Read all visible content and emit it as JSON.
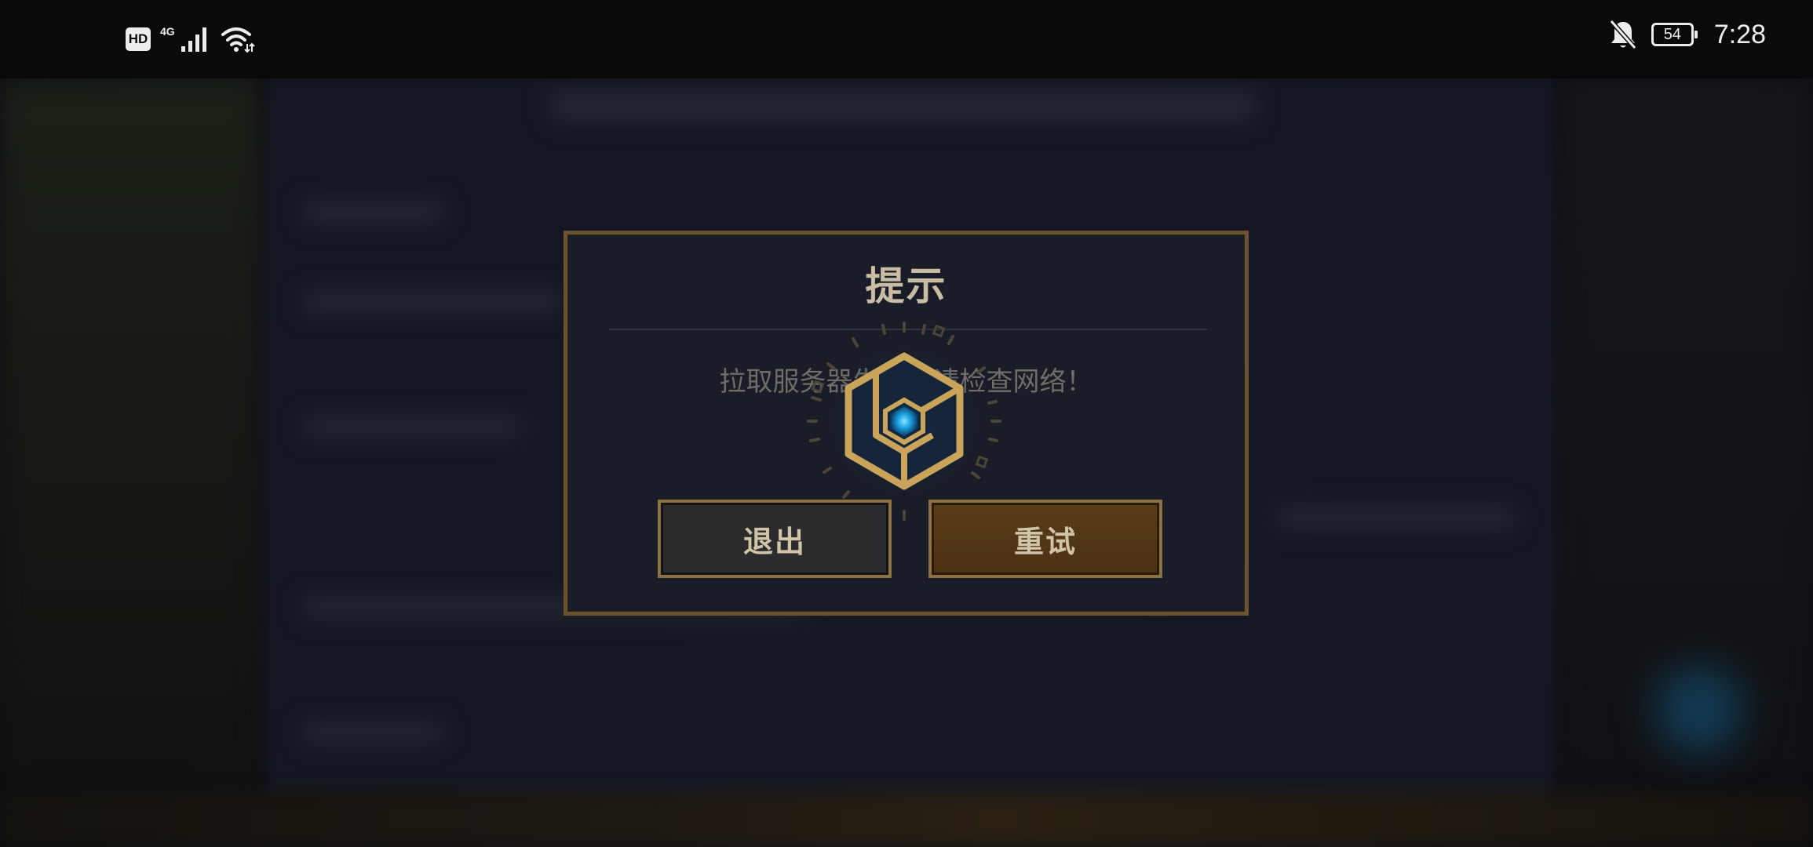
{
  "status_bar": {
    "hd_label": "HD",
    "network_type": "4G",
    "battery_level": "54",
    "time": "7:28",
    "icons": [
      "hd-icon",
      "cellular-signal-icon",
      "wifi-icon",
      "bell-muted-icon",
      "battery-icon"
    ]
  },
  "dialog": {
    "title": "提示",
    "message": "拉取服务器失败，请检查网络！",
    "buttons": {
      "exit_label": "退出",
      "retry_label": "重试"
    },
    "loader_icon": "hexagon-loading-icon"
  },
  "colors": {
    "dialog_border": "#6b5330",
    "dialog_background": "#1a1d27",
    "title_text": "#c8bca3",
    "retry_button": "#5a3d18",
    "exit_button": "#2b2b2d",
    "loader_gold": "#c9a45a",
    "loader_core": "#1ea8e8"
  }
}
